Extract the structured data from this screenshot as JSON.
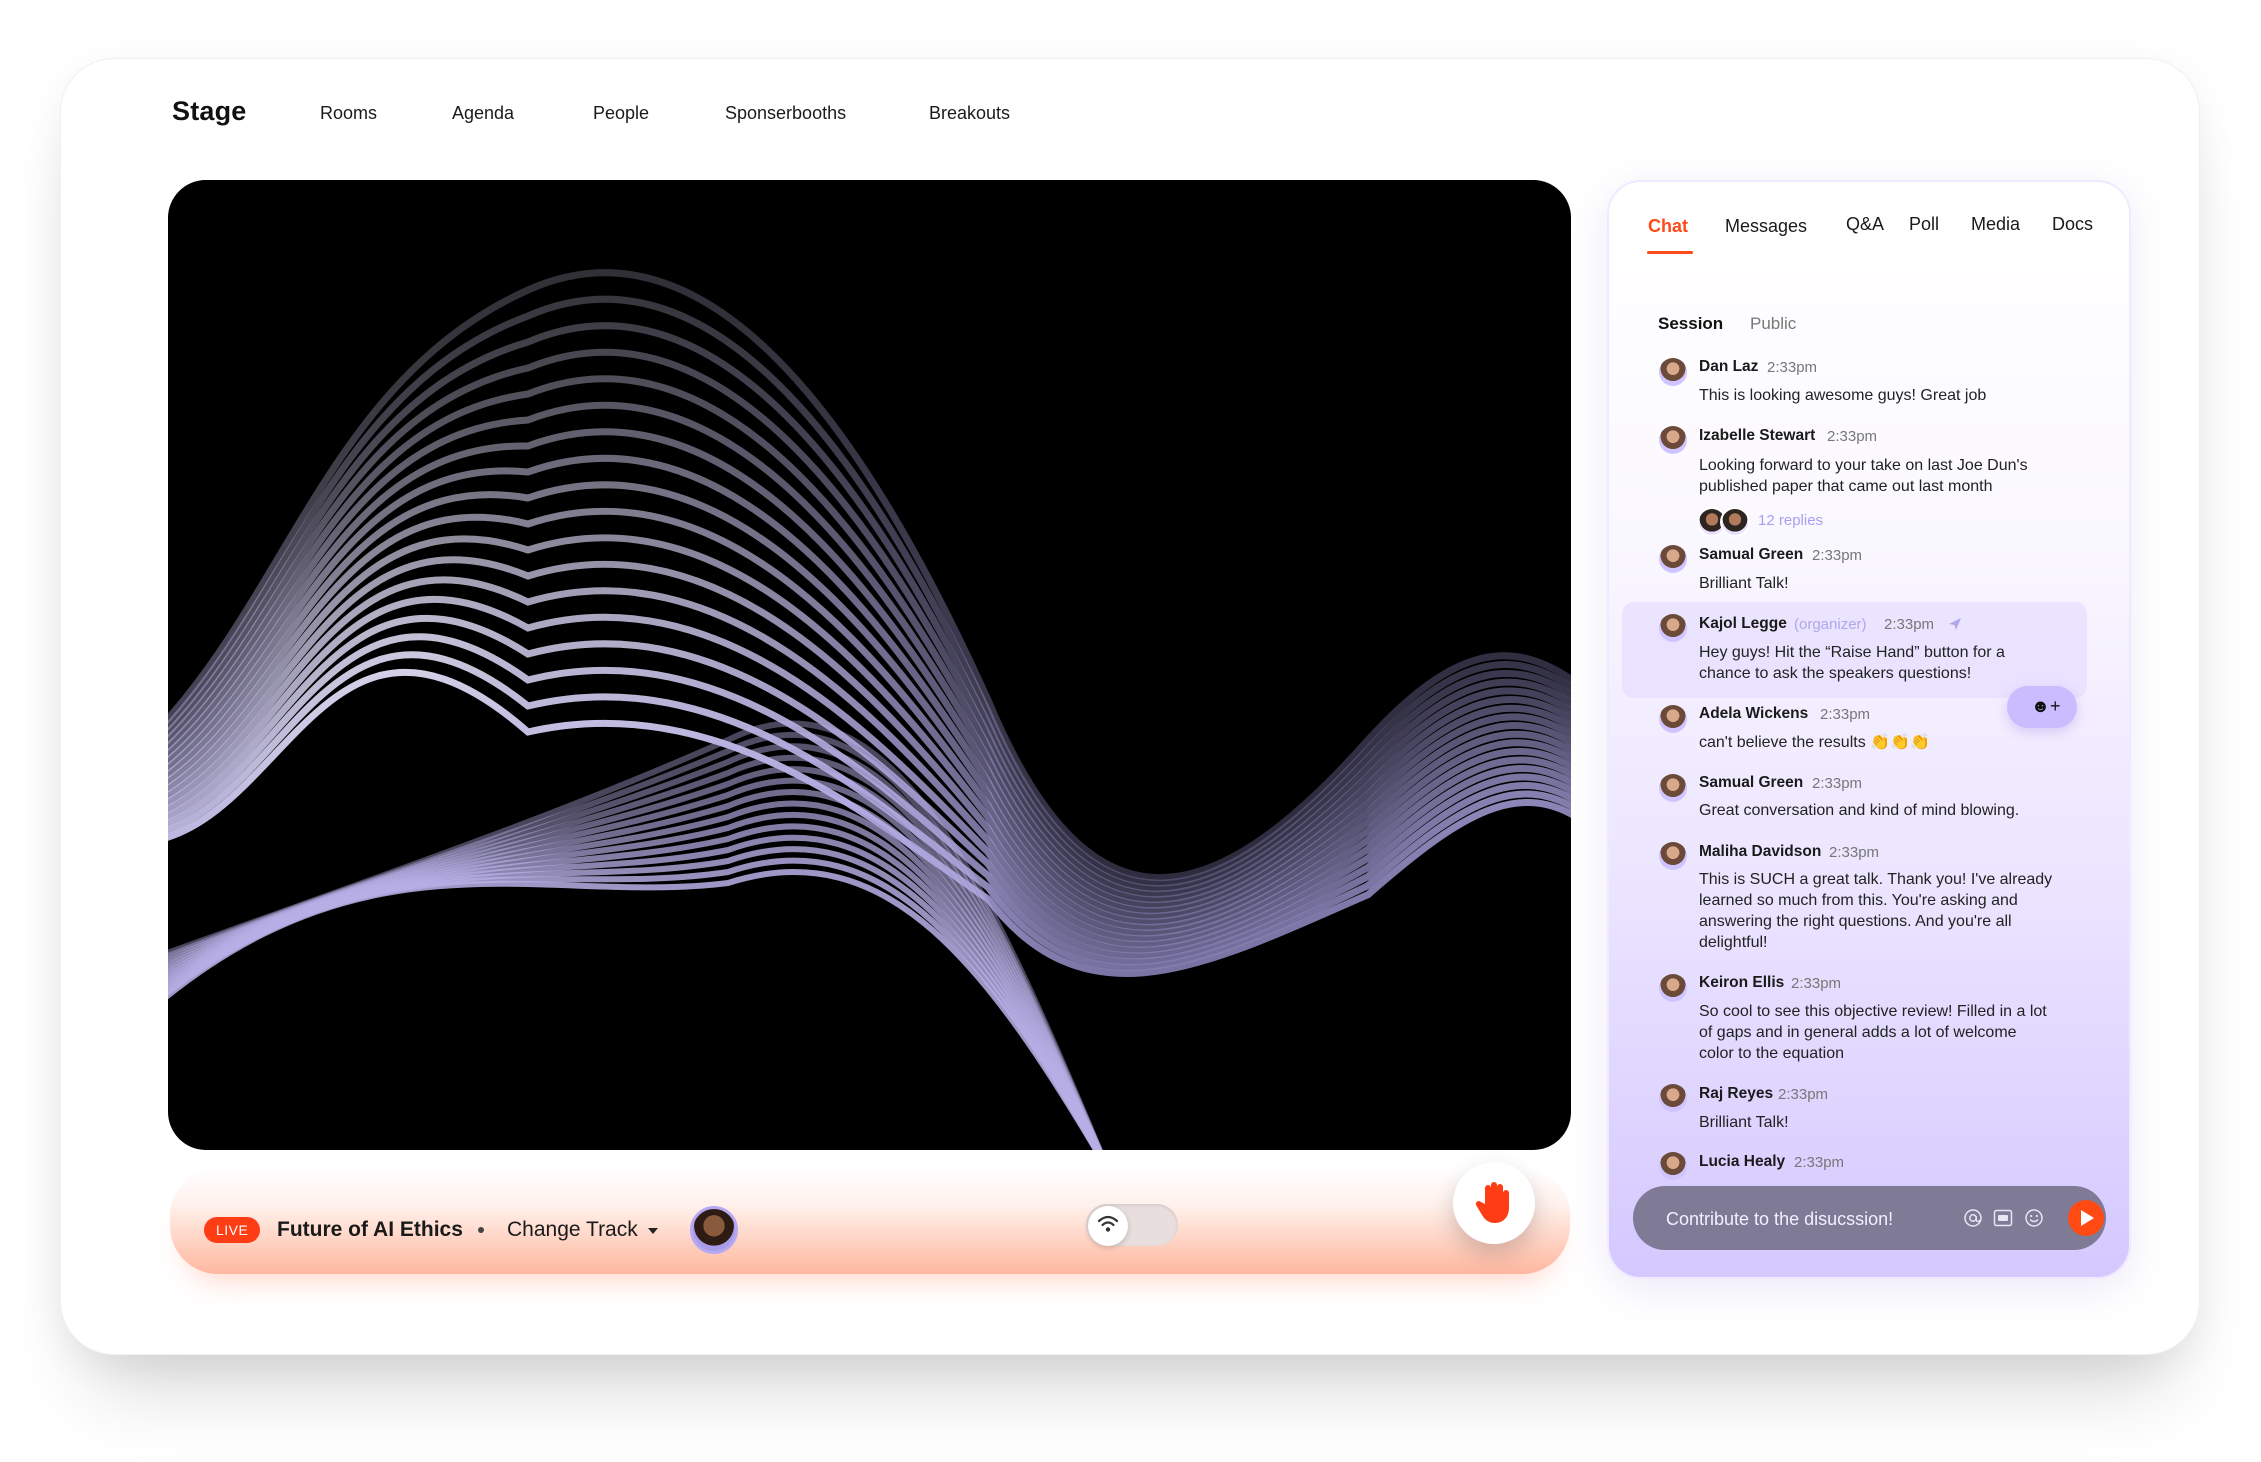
{
  "header": {
    "brand": "Stage",
    "nav": [
      "Rooms",
      "Agenda",
      "People",
      "Sponserbooths",
      "Breakouts"
    ]
  },
  "player": {
    "live_label": "LIVE",
    "session_title": "Future of AI Ethics",
    "change_track_label": "Change Track"
  },
  "chat": {
    "tabs": [
      "Chat",
      "Messages",
      "Q&A",
      "Poll",
      "Media",
      "Docs"
    ],
    "active_tab": "Chat",
    "subtabs": [
      "Session",
      "Public"
    ],
    "active_subtab": "Session",
    "messages": [
      {
        "author": "Dan Laz",
        "time": "2:33pm",
        "text": "This is looking awesome guys! Great job"
      },
      {
        "author": "Izabelle Stewart",
        "time": "2:33pm",
        "text": "Looking forward to your take on last Joe Dun's published paper that came out last month",
        "replies": "12 replies"
      },
      {
        "author": "Samual Green",
        "time": "2:33pm",
        "text": "Brilliant Talk!"
      },
      {
        "author": "Kajol Legge",
        "role": "(organizer)",
        "time": "2:33pm",
        "text": "Hey guys! Hit the “Raise Hand” button for a chance to ask the speakers questions!",
        "pinned": true
      },
      {
        "author": "Adela Wickens",
        "time": "2:33pm",
        "text": "can't believe the results 👏👏👏"
      },
      {
        "author": "Samual Green",
        "time": "2:33pm",
        "text": "Great conversation and kind of mind blowing."
      },
      {
        "author": "Maliha Davidson",
        "time": "2:33pm",
        "text": "This is SUCH a great talk. Thank you! I've already learned so much from this. You're asking and answering the right questions. And you're all delightful!"
      },
      {
        "author": "Keiron Ellis",
        "time": "2:33pm",
        "text": "So cool to see this objective review! Filled in a lot of gaps and in general adds a lot of welcome color to the equation"
      },
      {
        "author": "Raj Reyes",
        "time": "2:33pm",
        "text": "Brilliant Talk!"
      },
      {
        "author": "Lucia Healy",
        "time": "2:33pm",
        "text": ""
      }
    ],
    "input_placeholder": "Contribute to the disucssion!"
  },
  "colors": {
    "accent": "#ff4a1a",
    "chat_highlight": "#e8e0ff",
    "wave_line": "#c9c2ff"
  },
  "icons": [
    "wifi-icon",
    "raise-hand-icon",
    "pin-icon",
    "emoji-add-icon",
    "mention-icon",
    "gif-icon",
    "emoji-icon",
    "send-icon",
    "caret-down-icon"
  ]
}
